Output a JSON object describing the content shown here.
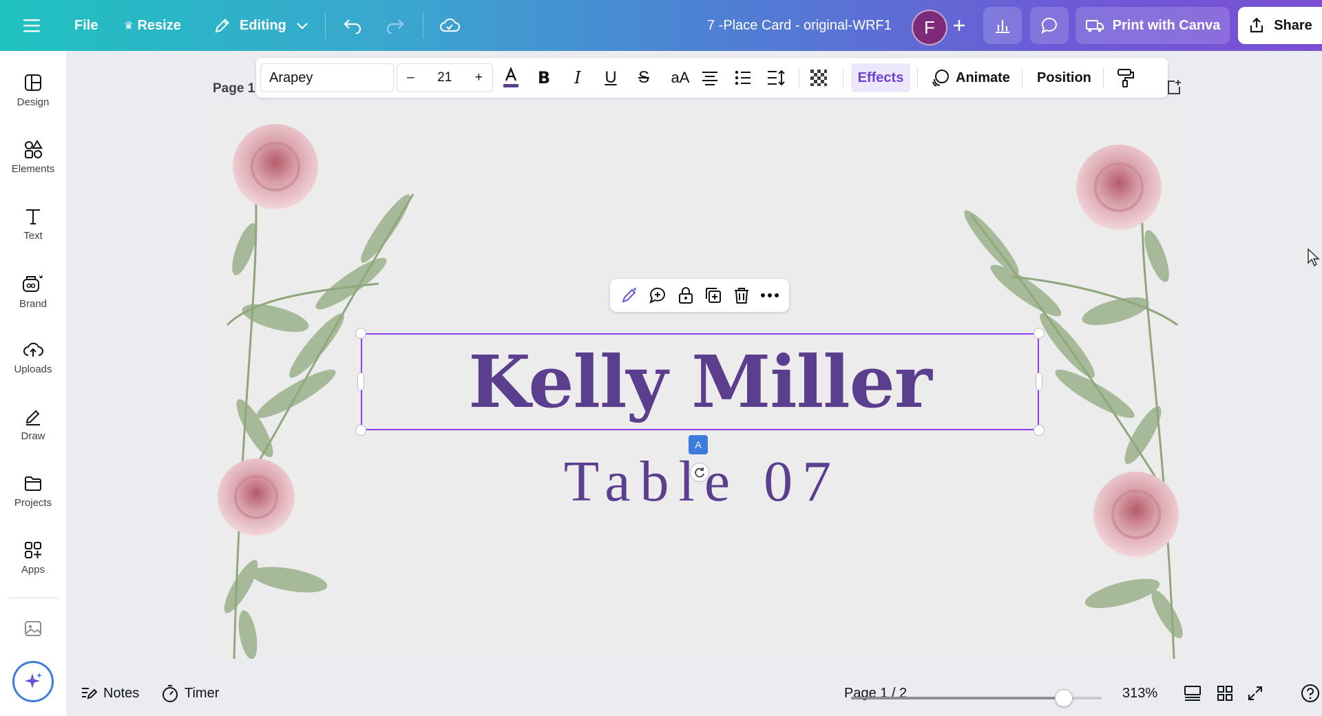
{
  "topbar": {
    "file_label": "File",
    "resize_label": "Resize",
    "editing_label": "Editing",
    "doc_title": "7 -Place Card - original-WRF1",
    "avatar_initial": "F",
    "print_label": "Print with Canva",
    "share_label": "Share"
  },
  "sidebar": {
    "items": [
      {
        "label": "Design",
        "icon": "design-icon"
      },
      {
        "label": "Elements",
        "icon": "elements-icon"
      },
      {
        "label": "Text",
        "icon": "text-icon"
      },
      {
        "label": "Brand",
        "icon": "brand-icon"
      },
      {
        "label": "Uploads",
        "icon": "uploads-icon"
      },
      {
        "label": "Draw",
        "icon": "draw-icon"
      },
      {
        "label": "Projects",
        "icon": "projects-icon"
      },
      {
        "label": "Apps",
        "icon": "apps-icon"
      }
    ]
  },
  "toolbar": {
    "font_name": "Arapey",
    "font_size": "21",
    "minus": "–",
    "plus": "+",
    "case_label": "aA",
    "effects_label": "Effects",
    "animate_label": "Animate",
    "position_label": "Position"
  },
  "canvas": {
    "page_label": "Page 1",
    "name_text": "Kelly Miller",
    "table_text": "Table 07",
    "text_color": "#5b3e8e",
    "selection_color": "#8b3dff"
  },
  "bottombar": {
    "notes_label": "Notes",
    "timer_label": "Timer",
    "page_indicator": "Page 1 / 2",
    "zoom_label": "313%",
    "zoom_fraction": 0.85
  },
  "colors": {
    "accent": "#8b3dff",
    "effects_bg": "#ede7fb",
    "avatar_bg": "#7d2a7a"
  }
}
